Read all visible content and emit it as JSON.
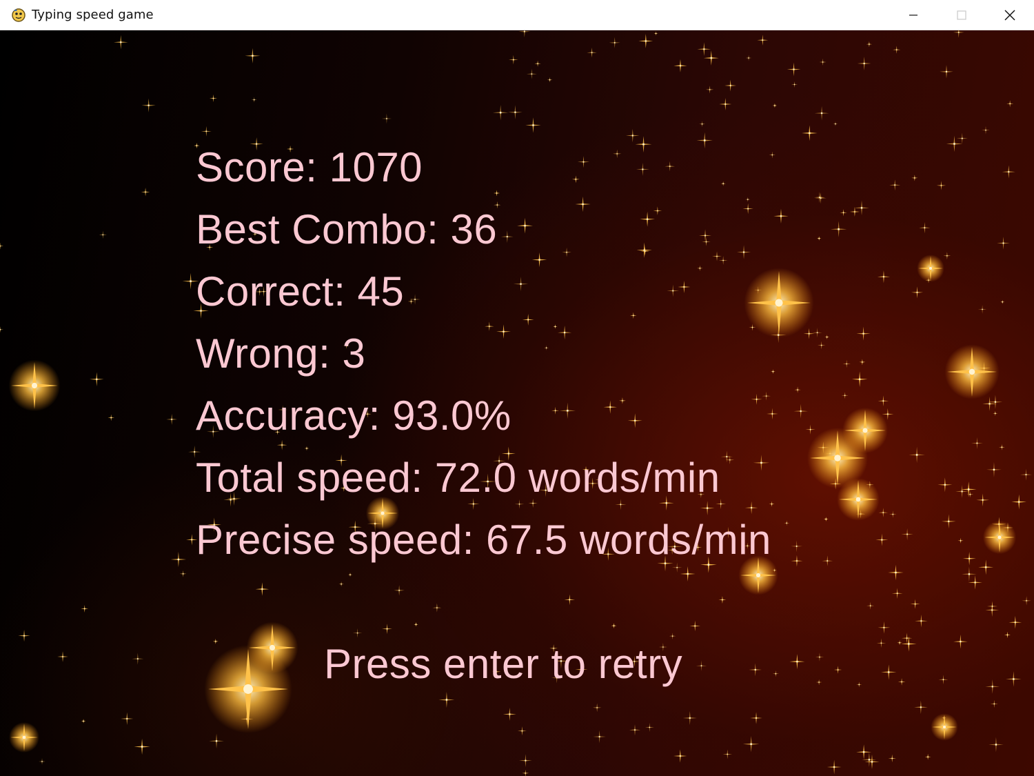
{
  "window": {
    "title": "Typing speed game",
    "app_icon": "pygame-snake-icon",
    "controls": [
      "minimize-icon",
      "maximize-icon",
      "close-icon"
    ]
  },
  "game": {
    "stats": {
      "score": "Score: 1070",
      "best_combo": "Best Combo: 36",
      "correct": "Correct: 45",
      "wrong": "Wrong: 3",
      "accuracy": "Accuracy: 93.0%",
      "total_speed": "Total speed: 72.0 words/min",
      "precise_speed": "Precise speed: 67.5 words/min"
    },
    "retry_prompt": "Press enter to retry",
    "colors": {
      "text": "#fbc8d2",
      "star": "#ffc24a",
      "background_dark": "#000000",
      "background_red": "#3d0800"
    }
  }
}
